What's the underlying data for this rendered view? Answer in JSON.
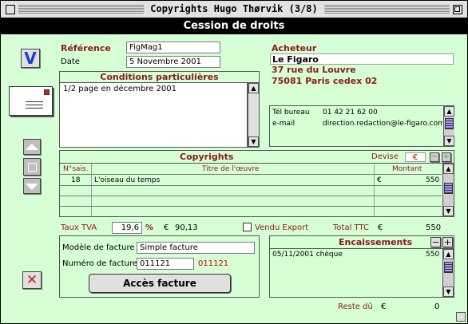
{
  "window": {
    "title": "Copyrights Hugo Thørvik (3/8)",
    "header": "Cession de droits"
  },
  "reference": {
    "label": "Référence",
    "value": "FigMag1"
  },
  "date": {
    "label": "Date",
    "value": "5 Novembre 2001"
  },
  "conditions": {
    "title": "Conditions particulières",
    "text": "1/2 page en décembre 2001"
  },
  "acheteur": {
    "label": "Acheteur",
    "name": "Le Figaro",
    "address1": "37 rue du Louvre",
    "address2": "75081 Paris cedex 02",
    "tel_label": "Tél bureau",
    "tel_value": "01 42 21 62 00",
    "email_label": "e-mail",
    "email_value": "direction.redaction@le-figaro.com"
  },
  "copyrights": {
    "title": "Copyrights",
    "devise_label": "Devise",
    "devise_value": "€",
    "columns": [
      "N°sais.",
      "Titre de l'œuvre",
      "Montant"
    ],
    "rows": [
      {
        "num": "18",
        "title": "L'oiseau du temps",
        "currency": "€",
        "amount": "550"
      }
    ]
  },
  "taux": {
    "label": "Taux TVA",
    "value": "19,6",
    "unit": "%",
    "currency": "€",
    "amount": "90,13"
  },
  "vendu_export": {
    "label": "Vendu Export",
    "checked": false
  },
  "total": {
    "label": "Total TTC",
    "currency": "€",
    "value": "550"
  },
  "facture": {
    "modele_label": "Modèle de facture",
    "modele_value": "Simple facture",
    "numero_label": "Numéro de facture",
    "numero_value": "011121",
    "numero_display": "011121",
    "button_label": "Accès facture"
  },
  "encaissements": {
    "title": "Encaissements",
    "rows": [
      {
        "text": "05/11/2001 chèque",
        "amount": "550"
      }
    ]
  },
  "reste": {
    "label": "Reste dû",
    "currency": "€",
    "value": "0"
  },
  "buttons": {
    "plus": "+",
    "minus": "−",
    "validate_glyph": "V",
    "delete_glyph": "✕"
  }
}
